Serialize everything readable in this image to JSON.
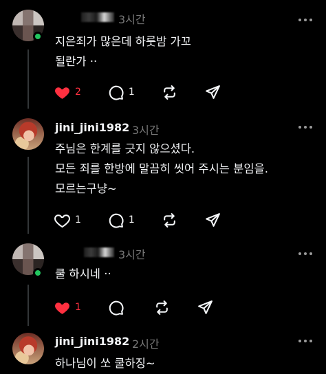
{
  "posts": [
    {
      "name": "",
      "time": "3시간",
      "text": "지은죄가 많은데 하룻밤 가꼬\n될란가  ··",
      "likes": "2",
      "liked": true,
      "replies": "1"
    },
    {
      "name": "jini_jini1982",
      "time": "3시간",
      "text": "주님은 한계를 긋지 않으셨다.\n모든 죄를 한방에 말끔히 씻어 주시는 분임을.\n모르는구냥~",
      "likes": "1",
      "liked": false,
      "replies": "1"
    },
    {
      "name": "",
      "time": "3시간",
      "text": "쿨 하시네  ··",
      "likes": "1",
      "liked": true,
      "replies": "0"
    },
    {
      "name": "jini_jini1982",
      "time": "2시간",
      "text": "하나님이 쏘 쿨하징~"
    }
  ],
  "colors": {
    "accent_like": "#ff3040",
    "online": "#22c55e",
    "muted": "#777777"
  },
  "icons": [
    "heart-icon",
    "reply-icon",
    "repost-icon",
    "share-icon",
    "more-icon"
  ]
}
